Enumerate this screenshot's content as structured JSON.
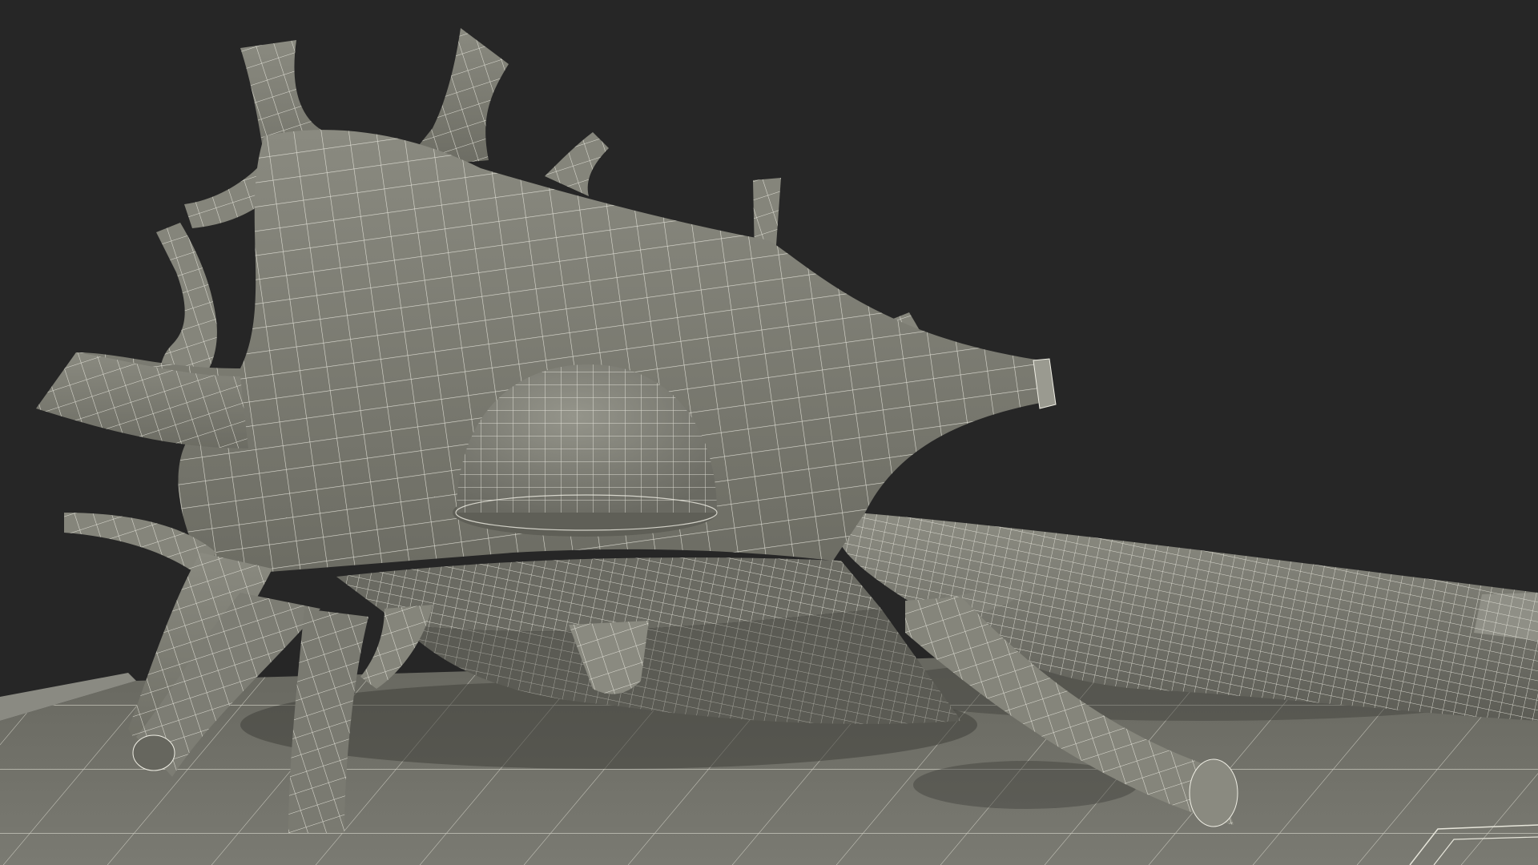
{
  "scene": {
    "subject": "neuron-wireframe-render",
    "colors": {
      "background": "#262626",
      "surface": "#7a7a70",
      "surface_light": "#8a8a80",
      "surface_dark": "#5f5f57",
      "shadow": "#4a4a44",
      "wire": "#efeee4",
      "ground": "#6e6e66",
      "ground_dark": "#56564f"
    }
  }
}
